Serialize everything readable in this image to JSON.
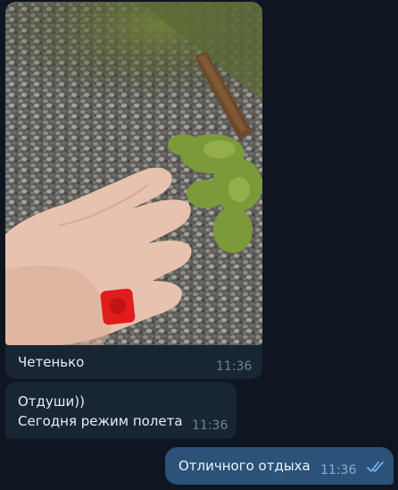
{
  "messages": [
    {
      "kind": "photo",
      "caption": "Четенько",
      "time": "11:36"
    },
    {
      "kind": "text",
      "lines": [
        "Отдуши))",
        "Сегодня режим полета"
      ],
      "time": "11:36"
    },
    {
      "kind": "outgoing",
      "text": "Отличного отдыха",
      "time": "11:36",
      "status": "read-double-check-icon"
    }
  ],
  "colors": {
    "background": "#0e1621",
    "incoming_bubble": "#182533",
    "outgoing_bubble": "#2b5278",
    "time_incoming": "#6f8396",
    "check_color": "#6ab3f3"
  }
}
